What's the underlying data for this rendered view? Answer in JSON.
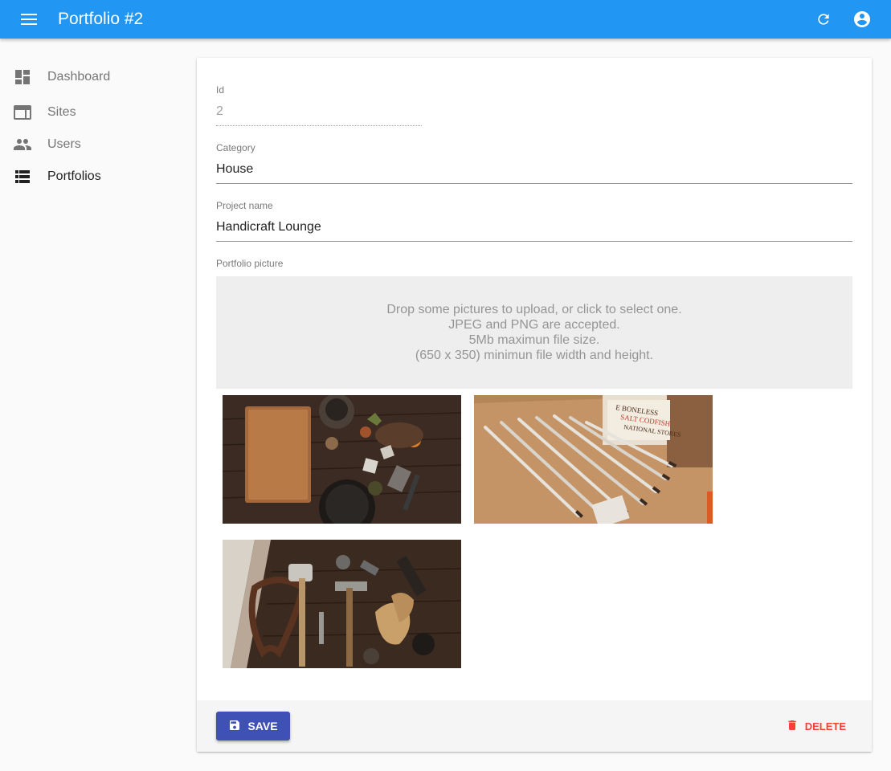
{
  "appbar": {
    "title": "Portfolio #2",
    "color": "#2196f3",
    "menu_icon": "menu-icon",
    "refresh_icon": "refresh-icon",
    "account_icon": "account-circle-icon"
  },
  "sidebar": {
    "items": [
      {
        "label": "Dashboard",
        "icon": "dashboard-icon",
        "active": false
      },
      {
        "label": "Sites",
        "icon": "web-icon",
        "active": false
      },
      {
        "label": "Users",
        "icon": "people-icon",
        "active": false
      },
      {
        "label": "Portfolios",
        "icon": "view-list-icon",
        "active": true
      }
    ]
  },
  "form": {
    "id": {
      "label": "Id",
      "value": "2"
    },
    "category": {
      "label": "Category",
      "value": "House"
    },
    "project_name": {
      "label": "Project name",
      "value": "Handicraft Lounge"
    },
    "picture": {
      "label": "Portfolio picture",
      "dropzone": [
        "Drop some pictures to upload, or click to select one.",
        "JPEG and PNG are accepted.",
        "5Mb maximun file size.",
        "(650 x 350) minimun file width and height."
      ],
      "images": [
        {
          "name": "portfolio-image-1",
          "subject": "kitchen items on wooden table"
        },
        {
          "name": "portfolio-image-2",
          "subject": "paint brushes on wooden table"
        },
        {
          "name": "portfolio-image-3",
          "subject": "hand tools on wooden table"
        }
      ]
    }
  },
  "footer": {
    "save_label": "SAVE",
    "save_color": "#3f51b5",
    "delete_label": "DELETE",
    "delete_color": "#f44336"
  }
}
